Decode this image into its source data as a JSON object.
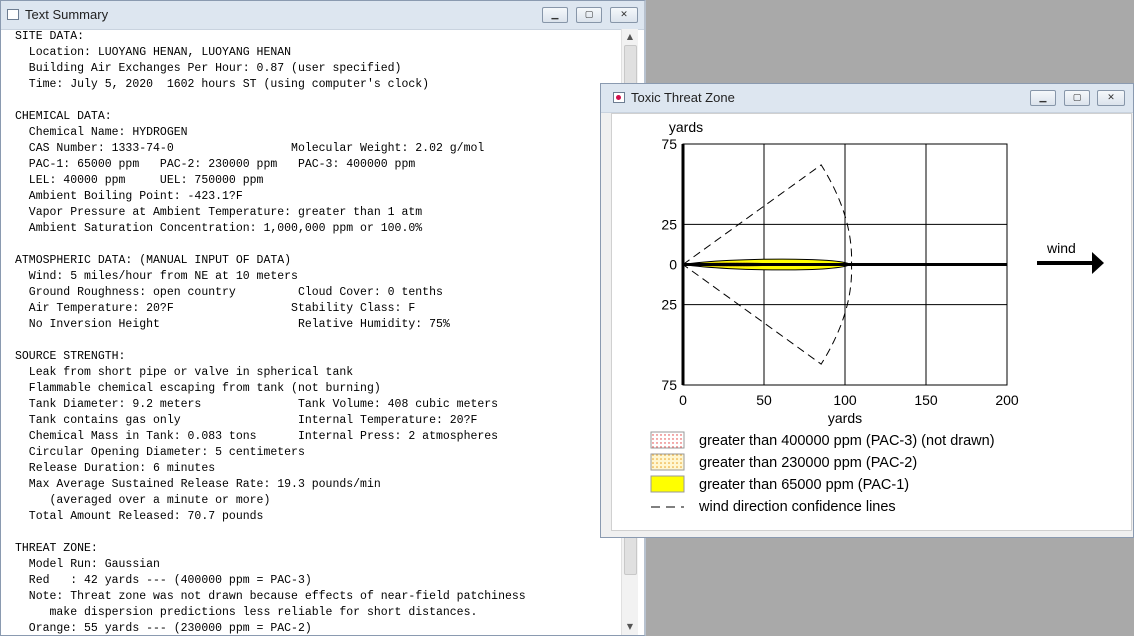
{
  "text_window": {
    "title": "Text Summary",
    "lines": [
      "SITE DATA:",
      "  Location: LUOYANG HENAN, LUOYANG HENAN",
      "  Building Air Exchanges Per Hour: 0.87 (user specified)",
      "  Time: July 5, 2020  1602 hours ST (using computer's clock)",
      "",
      "CHEMICAL DATA:",
      "  Chemical Name: HYDROGEN",
      "  CAS Number: 1333-74-0                 Molecular Weight: 2.02 g/mol",
      "  PAC-1: 65000 ppm   PAC-2: 230000 ppm   PAC-3: 400000 ppm",
      "  LEL: 40000 ppm     UEL: 750000 ppm",
      "  Ambient Boiling Point: -423.1?F",
      "  Vapor Pressure at Ambient Temperature: greater than 1 atm",
      "  Ambient Saturation Concentration: 1,000,000 ppm or 100.0%",
      "",
      "ATMOSPHERIC DATA: (MANUAL INPUT OF DATA)",
      "  Wind: 5 miles/hour from NE at 10 meters",
      "  Ground Roughness: open country         Cloud Cover: 0 tenths",
      "  Air Temperature: 20?F                 Stability Class: F",
      "  No Inversion Height                    Relative Humidity: 75%",
      "",
      "SOURCE STRENGTH:",
      "  Leak from short pipe or valve in spherical tank",
      "  Flammable chemical escaping from tank (not burning)",
      "  Tank Diameter: 9.2 meters              Tank Volume: 408 cubic meters",
      "  Tank contains gas only                 Internal Temperature: 20?F",
      "  Chemical Mass in Tank: 0.083 tons      Internal Press: 2 atmospheres",
      "  Circular Opening Diameter: 5 centimeters",
      "  Release Duration: 6 minutes",
      "  Max Average Sustained Release Rate: 19.3 pounds/min",
      "     (averaged over a minute or more)",
      "  Total Amount Released: 70.7 pounds",
      "",
      "THREAT ZONE:",
      "  Model Run: Gaussian",
      "  Red   : 42 yards --- (400000 ppm = PAC-3)",
      "  Note: Threat zone was not drawn because effects of near-field patchiness",
      "     make dispersion predictions less reliable for short distances.",
      "  Orange: 55 yards --- (230000 ppm = PAC-2)"
    ]
  },
  "plot_window": {
    "title": "Toxic Threat Zone",
    "wind_label": "wind",
    "legend": [
      {
        "label": "greater than 400000 ppm (PAC-3) (not drawn)",
        "swatch": "dotted-red"
      },
      {
        "label": "greater than 230000 ppm (PAC-2)",
        "swatch": "dotted-orange"
      },
      {
        "label": "greater than 65000 ppm (PAC-1)",
        "swatch": "yellow"
      },
      {
        "label": "wind direction confidence lines",
        "swatch": "dashed"
      }
    ],
    "colors": {
      "pac1": "#ffff00",
      "pac2_dot": "#e8a020",
      "pac3_dot": "#e03030"
    }
  },
  "chart_data": {
    "type": "area",
    "xlabel": "yards",
    "ylabel": "yards",
    "xlim": [
      0,
      200
    ],
    "ylim": [
      -75,
      75
    ],
    "x_ticks": [
      0,
      50,
      100,
      150,
      200
    ],
    "x_tick_labels": [
      "0",
      "50",
      "100",
      "150",
      "200"
    ],
    "y_ticks": [
      75,
      25,
      0,
      -25,
      -75
    ],
    "y_tick_labels": [
      "75",
      "25",
      "0",
      "25",
      "75"
    ],
    "grid": true,
    "series": [
      {
        "name": "greater than 65000 ppm (PAC-1)",
        "max_x": 103,
        "half_width": 4.5
      },
      {
        "name": "greater than 230000 ppm (PAC-2)",
        "max_x": 55,
        "half_width": 1.5
      }
    ],
    "confidence_lines": {
      "max_x": 104,
      "spread_y": 62
    }
  }
}
